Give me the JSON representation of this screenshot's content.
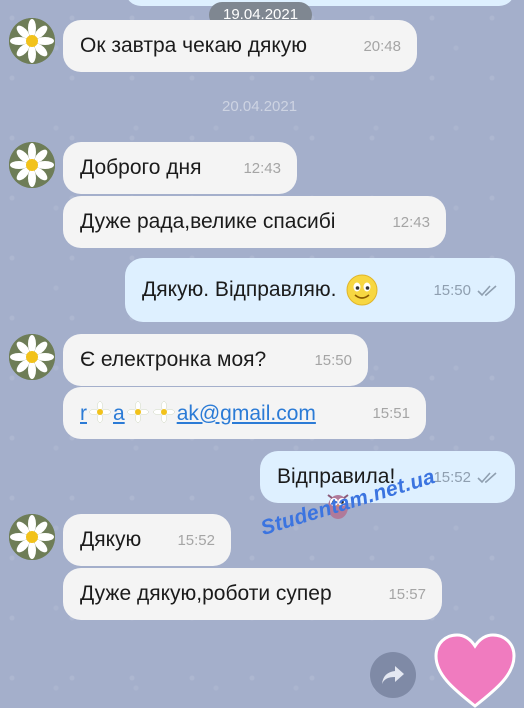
{
  "dates": {
    "top": "19.04.2021",
    "second": "20.04.2021"
  },
  "messages": [
    {
      "text": "Ок завтра чекаю дякую",
      "time": "20:48"
    },
    {
      "text": "Доброго дня",
      "time": "12:43"
    },
    {
      "text": "Дуже рада,велике спасибі",
      "time": "12:43"
    },
    {
      "text": "Дякую. Відправляю.",
      "time": "15:50"
    },
    {
      "text": "Є електронка моя?",
      "time": "15:50"
    },
    {
      "text_a": "r",
      "text_b": "a",
      "text_c": "ak@gmail.com",
      "time": "15:51"
    },
    {
      "text": "Відправила!",
      "time": "15:52"
    },
    {
      "text": "Дякую",
      "time": "15:52"
    },
    {
      "text": "Дуже дякую,роботи супер",
      "time": "15:57"
    }
  ],
  "watermark": "Studentam.net.ua",
  "icons": {
    "avatar": "daisy-avatar-icon",
    "read": "double-check-icon",
    "emoji": "smiley-emoji-icon",
    "share": "share-arrow-icon",
    "reaction": "heart-icon"
  },
  "colors": {
    "background": "#a4afcb",
    "incoming": "#f4f4f4",
    "outgoing": "#def0ff",
    "link": "#2b7bd6",
    "heart": "#f07bbf"
  }
}
